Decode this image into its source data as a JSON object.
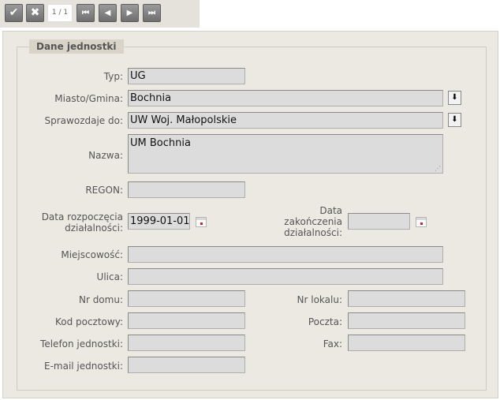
{
  "toolbar": {
    "accept_icon": "check-icon",
    "cancel_icon": "x-icon",
    "record_counter": "1 / 1",
    "first_icon": "first-record-icon",
    "prev_icon": "prev-record-icon",
    "next_icon": "next-record-icon",
    "last_icon": "last-record-icon"
  },
  "form": {
    "legend": "Dane jednostki",
    "typ": {
      "label": "Typ:",
      "value": "UG"
    },
    "miasto": {
      "label": "Miasto/Gmina:",
      "value": "Bochnia"
    },
    "sprawozdaje": {
      "label": "Sprawozdaje do:",
      "value": "UW Woj. Małopolskie"
    },
    "nazwa": {
      "label": "Nazwa:",
      "value": "UM Bochnia"
    },
    "regon": {
      "label": "REGON:",
      "value": ""
    },
    "data_rozp": {
      "label_line1": "Data rozpoczęcia",
      "label_line2": "działalności:",
      "value": "1999-01-01"
    },
    "data_zak": {
      "label_line1": "Data",
      "label_line2": "zakończenia",
      "label_line3": "działalności:",
      "value": ""
    },
    "miejscowosc": {
      "label": "Miejscowość:",
      "value": ""
    },
    "ulica": {
      "label": "Ulica:",
      "value": ""
    },
    "nr_domu": {
      "label": "Nr domu:",
      "value": ""
    },
    "nr_lokalu": {
      "label": "Nr lokalu:",
      "value": ""
    },
    "kod": {
      "label": "Kod pocztowy:",
      "value": ""
    },
    "poczta": {
      "label": "Poczta:",
      "value": ""
    },
    "telefon": {
      "label": "Telefon jednostki:",
      "value": ""
    },
    "fax": {
      "label": "Fax:",
      "value": ""
    },
    "email": {
      "label": "E-mail jednostki:",
      "value": ""
    }
  },
  "colors": {
    "panel_bg": "#ebe9e1",
    "input_bg": "#dcdcdc",
    "button_bg": "#7d7d7d"
  }
}
